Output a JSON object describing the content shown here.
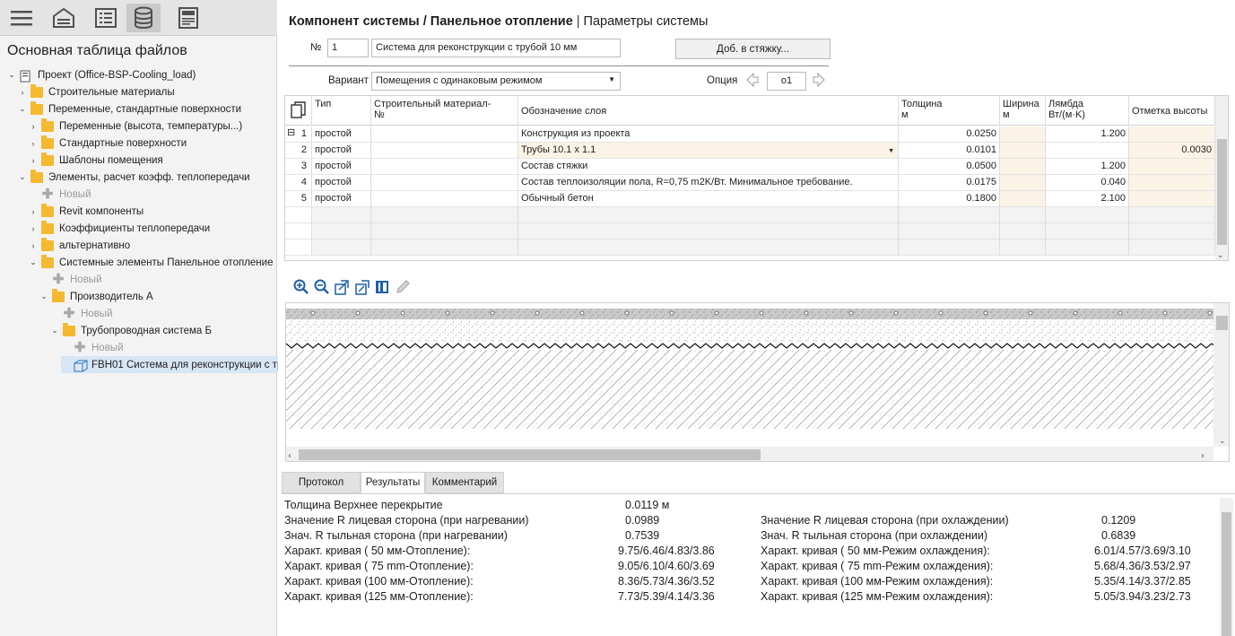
{
  "left_toolbar": {
    "buttons": [
      {
        "icon": "hamburger-menu-icon"
      },
      {
        "icon": "building-icon"
      },
      {
        "icon": "list-icon"
      },
      {
        "icon": "database-icon",
        "selected": true
      },
      {
        "icon": "form-icon"
      }
    ]
  },
  "tree": {
    "title": "Основная таблица файлов",
    "nodes": [
      {
        "level": 0,
        "arrow": "expanded",
        "icon": "project-icon",
        "label": "Проект (Office-BSP-Cooling_load)"
      },
      {
        "level": 1,
        "arrow": "collapsed",
        "icon": "folder-icon",
        "label": "Строительные материалы"
      },
      {
        "level": 1,
        "arrow": "expanded",
        "icon": "folder-icon",
        "label": "Переменные, стандартные поверхности"
      },
      {
        "level": 2,
        "arrow": "collapsed",
        "icon": "folder-icon",
        "label": "Переменные (высота, температуры...)"
      },
      {
        "level": 2,
        "arrow": "collapsed",
        "icon": "folder-icon",
        "label": "Стандартные поверхности"
      },
      {
        "level": 2,
        "arrow": "collapsed",
        "icon": "folder-icon",
        "label": "Шаблоны помещения"
      },
      {
        "level": 1,
        "arrow": "expanded",
        "icon": "folder-icon",
        "label": "Элементы, расчет коэфф. теплопередачи"
      },
      {
        "level": 2,
        "arrow": "none",
        "icon": "plus-icon",
        "label": "Новый",
        "muted": true
      },
      {
        "level": 2,
        "arrow": "collapsed",
        "icon": "folder-icon",
        "label": "Revit компоненты"
      },
      {
        "level": 2,
        "arrow": "collapsed",
        "icon": "folder-icon",
        "label": "Коэффициенты теплопередачи"
      },
      {
        "level": 2,
        "arrow": "collapsed",
        "icon": "folder-icon",
        "label": "альтернативно"
      },
      {
        "level": 2,
        "arrow": "expanded",
        "icon": "folder-icon",
        "label": "Системные элементы Панельное отопление"
      },
      {
        "level": 3,
        "arrow": "none",
        "icon": "plus-icon",
        "label": "Новый",
        "muted": true
      },
      {
        "level": 3,
        "arrow": "expanded",
        "icon": "folder-icon",
        "label": "Производитель А"
      },
      {
        "level": 4,
        "arrow": "none",
        "icon": "plus-icon",
        "label": "Новый",
        "muted": true
      },
      {
        "level": 4,
        "arrow": "expanded",
        "icon": "folder-icon",
        "label": "Трубопроводная система Б"
      },
      {
        "level": 5,
        "arrow": "none",
        "icon": "plus-icon",
        "label": "Новый",
        "muted": true
      },
      {
        "level": 5,
        "arrow": "none",
        "icon": "component-icon",
        "label": "FBH01 Система для реконструкции с тр",
        "selected": true
      }
    ]
  },
  "header": {
    "title": "Компонент системы / Панельное отопление",
    "subtitle": "Параметры системы"
  },
  "form": {
    "number_label": "№",
    "number_value": "1",
    "name_value": "Система для реконструкции с трубой 10 мм",
    "add_screed_button": "Доб. в стяжку...",
    "variant_label": "Вариант",
    "variant_value": "Помещения с одинаковым режимом",
    "option_label": "Опция",
    "option_value": "o1"
  },
  "layer_table": {
    "columns": [
      "Тип",
      "Строительный материал-\n№",
      "Обозначение слоя",
      "Толщина\nм",
      "Ширина\nм",
      "Лямбда\nВт/(м·K)",
      "Отметка высоты"
    ],
    "rows": [
      {
        "n": "1",
        "type": "простой",
        "material": "",
        "name": "Конструкция из проекта",
        "thickness": "0.0250",
        "width": "",
        "lambda": "1.200",
        "height": ""
      },
      {
        "n": "2",
        "type": "простой",
        "material": "",
        "name": "Трубы  10.1 x 1.1",
        "thickness": "0.0101",
        "width": "",
        "lambda": "",
        "height": "0.0030"
      },
      {
        "n": "3",
        "type": "простой",
        "material": "",
        "name": "Состав стяжки",
        "thickness": "0.0500",
        "width": "",
        "lambda": "1.200",
        "height": ""
      },
      {
        "n": "4",
        "type": "простой",
        "material": "",
        "name": "Состав теплоизоляции пола, R=0,75 m2K/Вт. Минимальное требование.",
        "thickness": "0.0175",
        "width": "",
        "lambda": "0.040",
        "height": ""
      },
      {
        "n": "5",
        "type": "простой",
        "material": "",
        "name": "Обычный бетон",
        "thickness": "0.1800",
        "width": "",
        "lambda": "2.100",
        "height": ""
      }
    ]
  },
  "drawing_toolbar": {
    "icons": [
      "zoom-in-icon",
      "zoom-out-icon",
      "fit-width-icon",
      "fit-height-icon",
      "book-icon",
      "pencil-icon"
    ]
  },
  "tabs": {
    "items": [
      {
        "label": "Протокол",
        "active": false
      },
      {
        "label": "Результаты",
        "active": true
      },
      {
        "label": "Комментарий",
        "active": false
      }
    ]
  },
  "results": {
    "left": [
      {
        "label": "Толщина Верхнее перекрытие",
        "value": "0.0119 м"
      },
      {
        "label": "Значение R лицевая сторона (при нагревании)",
        "value": "0.0989"
      },
      {
        "label": "Знач. R тыльная сторона (при нагревании)",
        "value": "0.7539"
      },
      {
        "label": "Характ. кривая ( 50 мм-Отопление):",
        "value": "9.75/6.46/4.83/3.86"
      },
      {
        "label": "Характ. кривая ( 75 mm-Отопление):",
        "value": "9.05/6.10/4.60/3.69"
      },
      {
        "label": "Характ. кривая (100 мм-Отопление):",
        "value": "8.36/5.73/4.36/3.52"
      },
      {
        "label": "Характ. кривая (125 мм-Отопление):",
        "value": "7.73/5.39/4.14/3.36"
      }
    ],
    "right": [
      {
        "label": "Значение R лицевая сторона (при охлаждении)",
        "value": "0.1209"
      },
      {
        "label": "Знач. R тыльная сторона (при охлаждении)",
        "value": "0.6839"
      },
      {
        "label": "Характ. кривая ( 50 мм-Режим охлаждения):",
        "value": "6.01/4.57/3.69/3.10"
      },
      {
        "label": "Характ. кривая ( 75 mm-Режим охлаждения):",
        "value": "5.68/4.36/3.53/2.97"
      },
      {
        "label": "Характ. кривая (100 мм-Режим охлаждения):",
        "value": "5.35/4.14/3.37/2.85"
      },
      {
        "label": "Характ. кривая (125 мм-Режим охлаждения):",
        "value": "5.05/3.94/3.23/2.73"
      }
    ]
  },
  "colors": {
    "folder": "#f5b930",
    "selection": "#d7e6f5",
    "editable_cell": "#fbf3e6",
    "zoom_icon": "#1f5fa8"
  }
}
